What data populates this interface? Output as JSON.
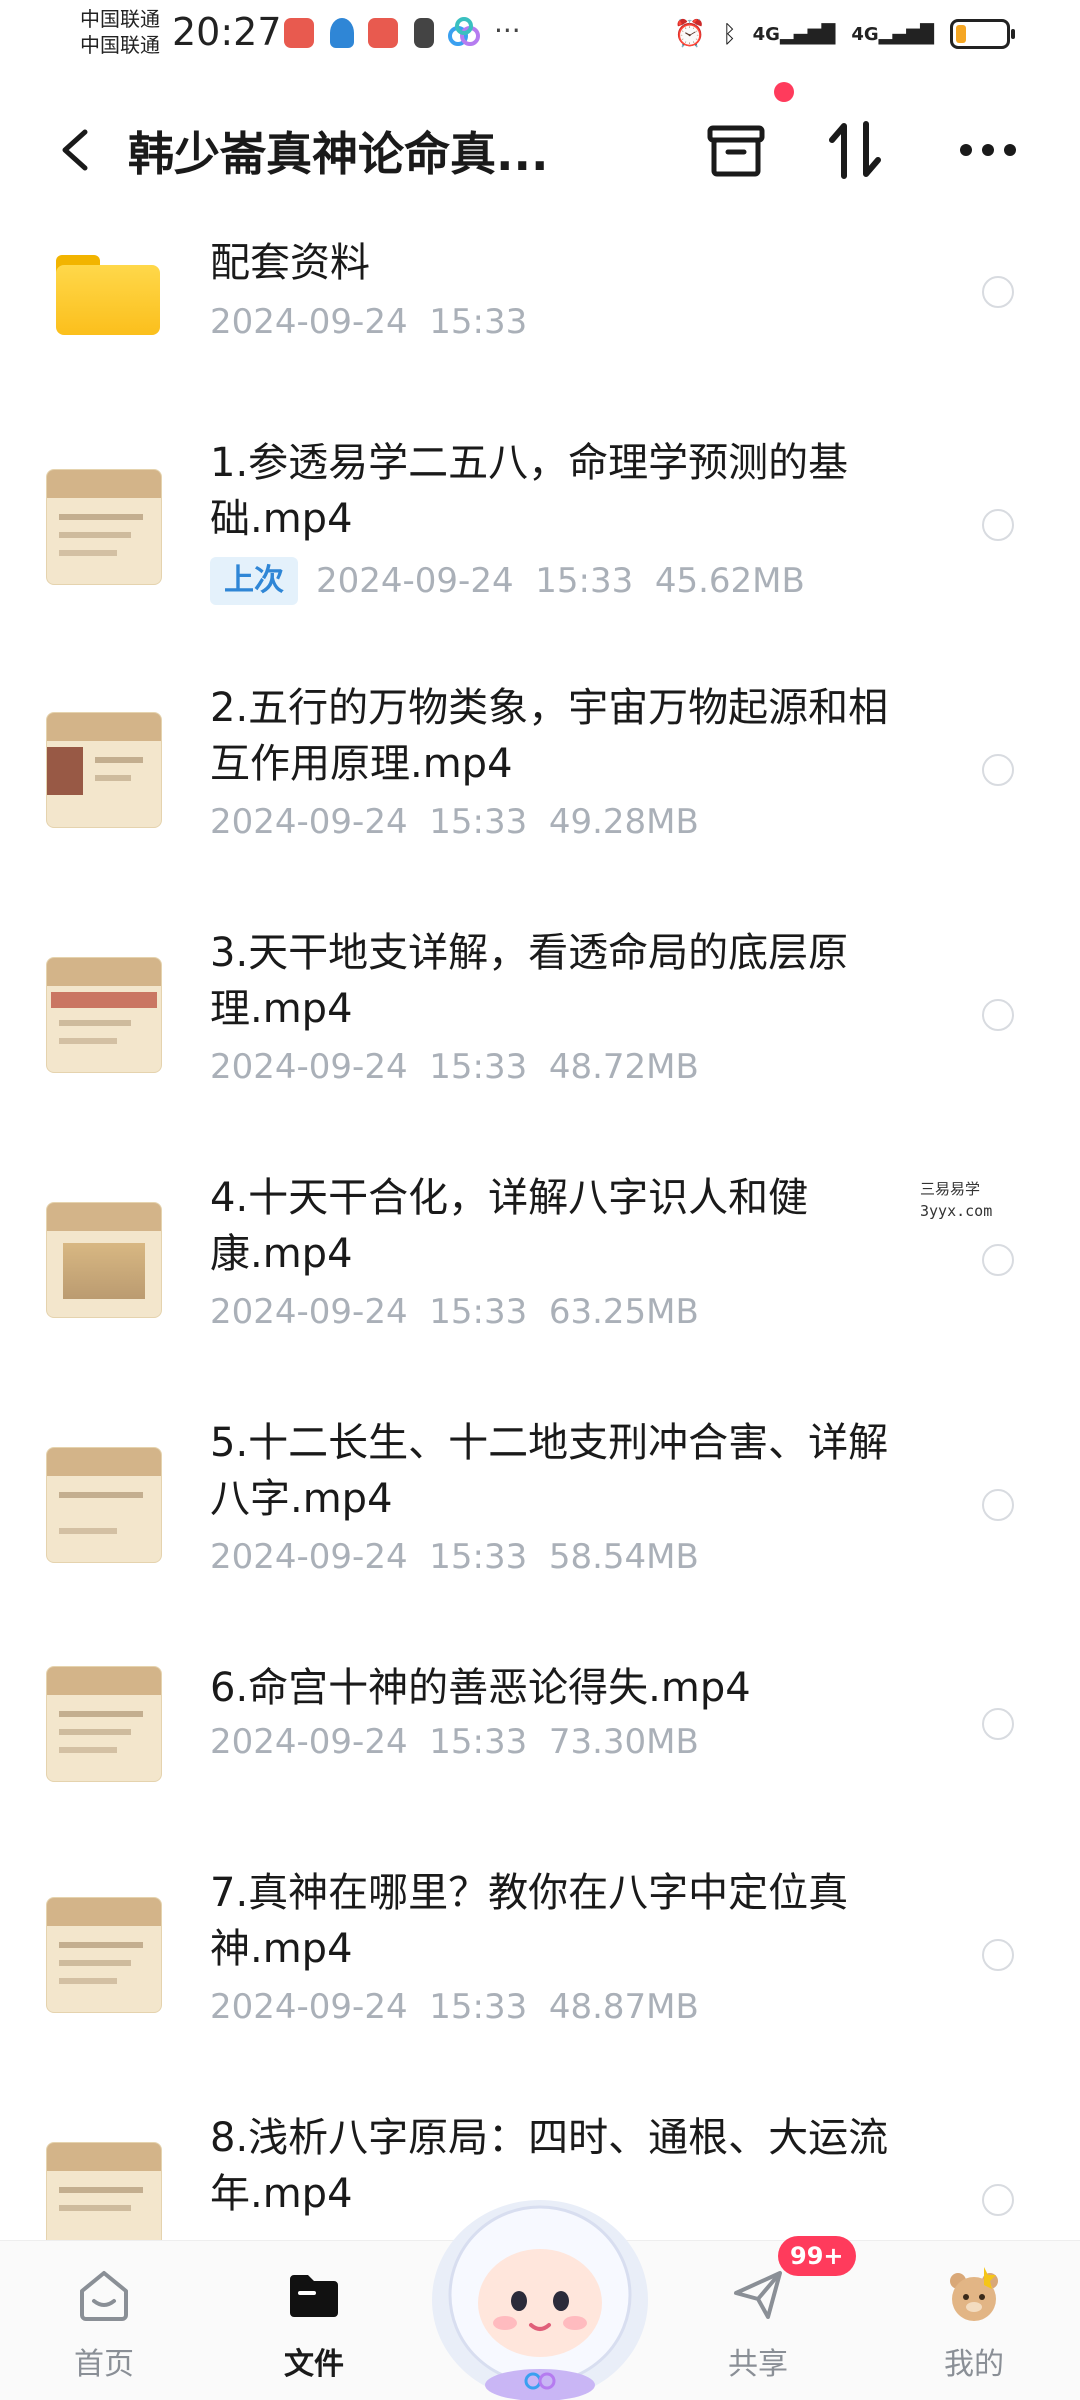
{
  "status_bar": {
    "carrier_1": "中国联通",
    "carrier_2": "中国联通",
    "time": "20:27",
    "network_1": "4G",
    "network_2": "4G",
    "battery_level": 0.2
  },
  "header": {
    "title": "韩少崙真神论命真...",
    "back_icon": "back-arrow-icon",
    "notification_dot_color": "#ff3b5c"
  },
  "files": [
    {
      "type": "folder",
      "name": "配套资料",
      "date": "2024-09-24",
      "time": "15:33",
      "size": "",
      "tag": ""
    },
    {
      "type": "video",
      "name": "1.参透易学二五八，命理学预测的基础.mp4",
      "date": "2024-09-24",
      "time": "15:33",
      "size": "45.62MB",
      "tag": "上次"
    },
    {
      "type": "video",
      "name": "2.五行的万物类象，宇宙万物起源和相互作用原理.mp4",
      "date": "2024-09-24",
      "time": "15:33",
      "size": "49.28MB",
      "tag": ""
    },
    {
      "type": "video",
      "name": "3.天干地支详解，看透命局的底层原理.mp4",
      "date": "2024-09-24",
      "time": "15:33",
      "size": "48.72MB",
      "tag": ""
    },
    {
      "type": "video",
      "name": "4.十天干合化，详解八字识人和健康.mp4",
      "date": "2024-09-24",
      "time": "15:33",
      "size": "63.25MB",
      "tag": ""
    },
    {
      "type": "video",
      "name": "5.十二长生、十二地支刑冲合害、详解八字.mp4",
      "date": "2024-09-24",
      "time": "15:33",
      "size": "58.54MB",
      "tag": ""
    },
    {
      "type": "video",
      "name": "6.命宫十神的善恶论得失.mp4",
      "date": "2024-09-24",
      "time": "15:33",
      "size": "73.30MB",
      "tag": ""
    },
    {
      "type": "video",
      "name": "7.真神在哪里？教你在八字中定位真神.mp4",
      "date": "2024-09-24",
      "time": "15:33",
      "size": "48.87MB",
      "tag": ""
    },
    {
      "type": "video",
      "name": "8.浅析八字原局：四时、通根、大运流年.mp4",
      "date": "",
      "time": "",
      "size": "",
      "tag": ""
    }
  ],
  "watermark": {
    "line1": "三易易学",
    "line2": "3yyx.com"
  },
  "bottom_nav": {
    "items": [
      {
        "label": "首页",
        "icon": "home-icon"
      },
      {
        "label": "文件",
        "icon": "folder-icon",
        "active": true
      },
      {
        "label": "共享",
        "icon": "send-icon"
      },
      {
        "label": "我的",
        "icon": "profile-bear-icon"
      }
    ],
    "share_badge": "99+",
    "accent_color": "#ff3b5c"
  }
}
